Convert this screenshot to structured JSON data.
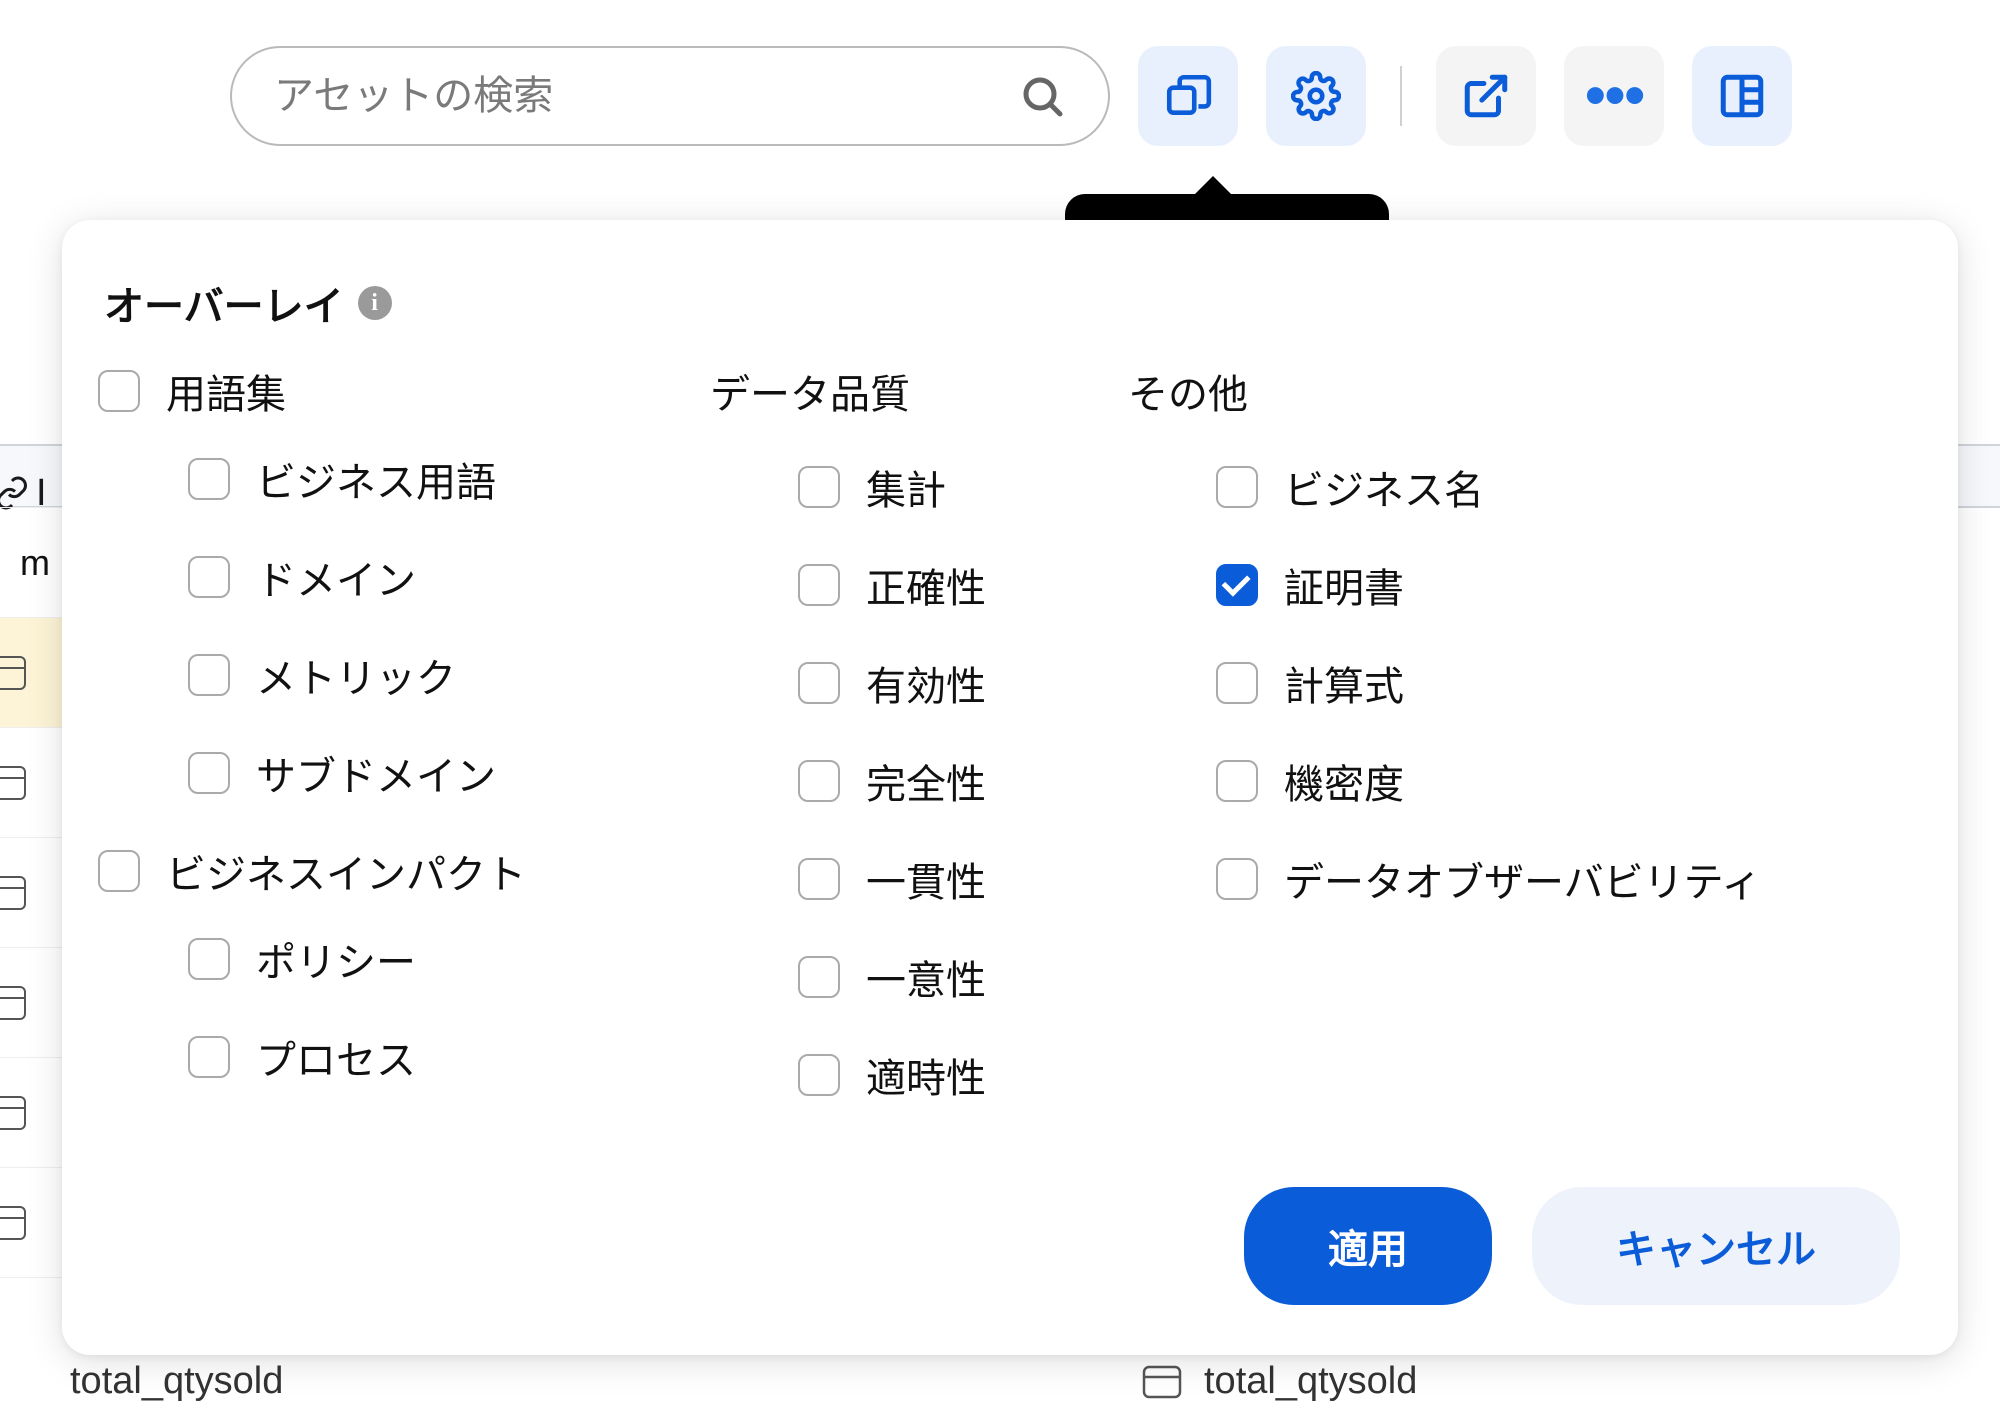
{
  "toolbar": {
    "search_placeholder": "アセットの検索"
  },
  "tooltip": {
    "overlay_label": "オーバーレイ"
  },
  "panel": {
    "title": "オーバーレイ",
    "columns": {
      "glossary": {
        "group_label": "用語集",
        "items": {
          "business_term": "ビジネス用語",
          "domain": "ドメイン",
          "metric": "メトリック",
          "subdomain": "サブドメイン"
        }
      },
      "business_impact": {
        "group_label": "ビジネスインパクト",
        "items": {
          "policy": "ポリシー",
          "process": "プロセス"
        }
      },
      "data_quality": {
        "group_label": "データ品質",
        "items": {
          "aggregation": "集計",
          "accuracy": "正確性",
          "validity": "有効性",
          "completeness": "完全性",
          "consistency": "一貫性",
          "uniqueness": "一意性",
          "timeliness": "適時性"
        }
      },
      "other": {
        "group_label": "その他",
        "items": {
          "business_name": "ビジネス名",
          "certificate": "証明書",
          "formula": "計算式",
          "confidentiality": "機密度",
          "data_observability": "データオブザーバビリティ"
        },
        "checked": {
          "certificate": true
        }
      }
    },
    "actions": {
      "apply": "適用",
      "cancel": "キャンセル"
    }
  },
  "background": {
    "partial_l": "I",
    "partial_m": "m",
    "bottom_text": "total_qtysold",
    "bottom_text2": "total_qtysold"
  }
}
